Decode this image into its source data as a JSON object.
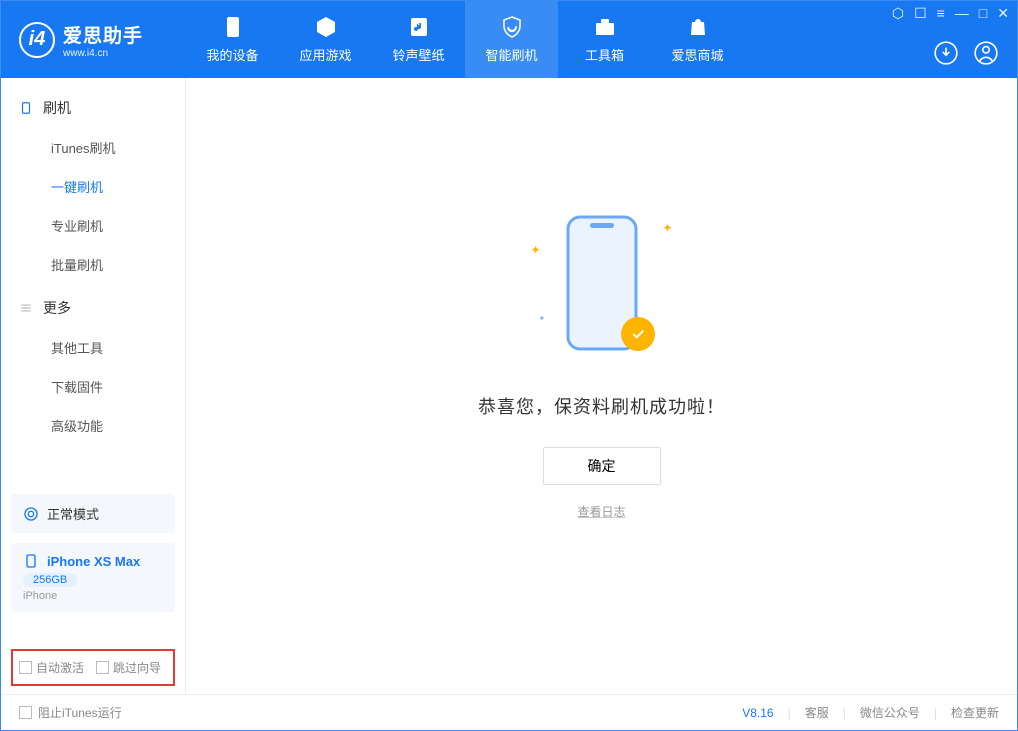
{
  "app": {
    "name": "爱思助手",
    "url": "www.i4.cn"
  },
  "nav": {
    "my_device": "我的设备",
    "apps_games": "应用游戏",
    "ring_wall": "铃声壁纸",
    "smart_flash": "智能刷机",
    "toolbox": "工具箱",
    "store": "爱思商城"
  },
  "sidebar": {
    "flash": {
      "title": "刷机",
      "items": [
        "iTunes刷机",
        "一键刷机",
        "专业刷机",
        "批量刷机"
      ]
    },
    "more": {
      "title": "更多",
      "items": [
        "其他工具",
        "下载固件",
        "高级功能"
      ]
    },
    "mode_label": "正常模式",
    "device": {
      "name": "iPhone XS Max",
      "capacity": "256GB",
      "type": "iPhone"
    },
    "auto_activate": "自动激活",
    "skip_guide": "跳过向导"
  },
  "main": {
    "success_msg": "恭喜您，保资料刷机成功啦！",
    "confirm": "确定",
    "view_log": "查看日志"
  },
  "footer": {
    "block_itunes": "阻止iTunes运行",
    "version": "V8.16",
    "support": "客服",
    "wechat": "微信公众号",
    "update": "检查更新"
  }
}
